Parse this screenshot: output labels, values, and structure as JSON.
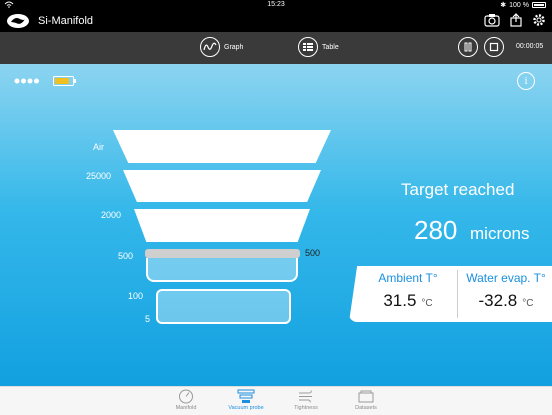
{
  "statusbar": {
    "time": "15:23",
    "battery": "100 %"
  },
  "app": {
    "title": "Si-Manifold"
  },
  "toolbar": {
    "graph_label": "Graph",
    "table_label": "Table",
    "timer": "00:00:05"
  },
  "probe": {
    "scale_labels": [
      "Air",
      "25000",
      "2000",
      "500",
      "100",
      "5"
    ],
    "marker_value": "500",
    "info_icon": "i",
    "status": "Target reached",
    "reading_value": "280",
    "reading_unit": "microns"
  },
  "ambient": {
    "label": "Ambient T°",
    "value": "31.5",
    "unit": "°C"
  },
  "water": {
    "label": "Water evap. T°",
    "value": "-32.8",
    "unit": "°C"
  },
  "tabs": [
    {
      "label": "Manifold",
      "icon": "gauge-icon"
    },
    {
      "label": "Vacuum probe",
      "icon": "vacuum-probe-icon"
    },
    {
      "label": "Tightness",
      "icon": "wind-icon"
    },
    {
      "label": "Datasets",
      "icon": "folder-icon"
    }
  ],
  "colors": {
    "accent": "#1b8fe0",
    "toolbar": "#3a3a3a",
    "gradient_top": "#8cd4f0",
    "gradient_bottom": "#12a0e0"
  }
}
